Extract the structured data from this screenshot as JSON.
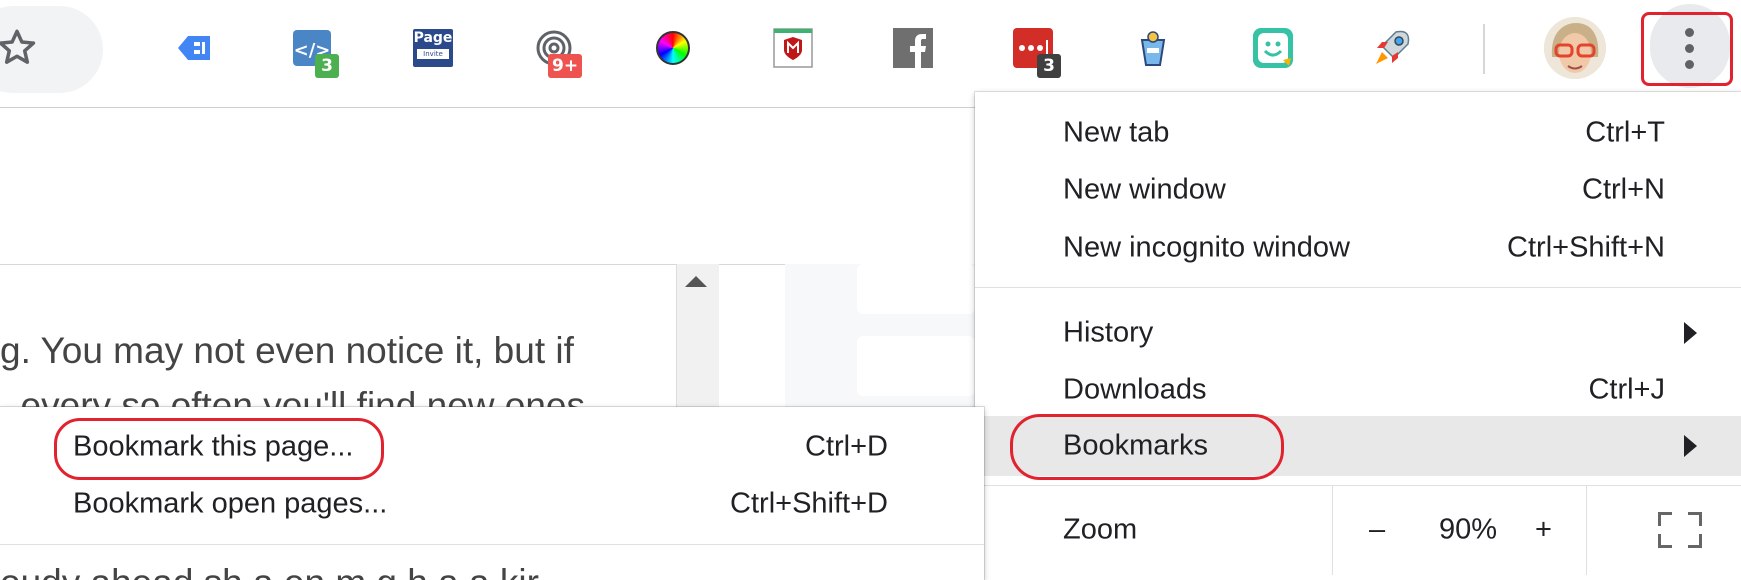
{
  "toolbar": {
    "star_icon": "star-outline-icon",
    "extensions": [
      {
        "name": "tag-extension-icon",
        "badge": ""
      },
      {
        "name": "code-extension-icon",
        "badge": "3"
      },
      {
        "name": "page-invite-extension-icon",
        "badge": "",
        "text_top": "Page",
        "text_bottom": "Invite"
      },
      {
        "name": "spiral-extension-icon",
        "badge": "9+"
      },
      {
        "name": "color-wheel-extension-icon",
        "badge": ""
      },
      {
        "name": "mcafee-extension-icon",
        "badge": ""
      },
      {
        "name": "facebook-extension-icon",
        "badge": ""
      },
      {
        "name": "lastpass-extension-icon",
        "badge": "3"
      },
      {
        "name": "bucket-extension-icon",
        "badge": ""
      },
      {
        "name": "smiley-extension-icon",
        "badge": ""
      },
      {
        "name": "rocket-extension-icon",
        "badge": ""
      }
    ],
    "avatar_icon": "profile-avatar-icon",
    "menu_icon": "more-vert-icon"
  },
  "page": {
    "line1": "g. You may not even notice it, but if",
    "line2": ", every so often you'll find new ones",
    "line3": "oudy ahead sh a en m g h a a kir"
  },
  "main_menu": {
    "items": [
      {
        "label": "New tab",
        "shortcut": "Ctrl+T"
      },
      {
        "label": "New window",
        "shortcut": "Ctrl+N"
      },
      {
        "label": "New incognito window",
        "shortcut": "Ctrl+Shift+N"
      },
      {
        "label": "History",
        "shortcut": ""
      },
      {
        "label": "Downloads",
        "shortcut": "Ctrl+J"
      },
      {
        "label": "Bookmarks",
        "shortcut": ""
      }
    ],
    "zoom": {
      "label": "Zoom",
      "minus": "–",
      "value": "90%",
      "plus": "+"
    },
    "fullscreen_icon": "fullscreen-icon"
  },
  "bookmarks_menu": {
    "items": [
      {
        "label": "Bookmark this page...",
        "shortcut": "Ctrl+D"
      },
      {
        "label": "Bookmark open pages...",
        "shortcut": "Ctrl+Shift+D"
      }
    ]
  },
  "colors": {
    "highlight": "#e0232e",
    "menu_hover": "#e8e8e8",
    "toolbar_pill": "#f1f3f4"
  }
}
